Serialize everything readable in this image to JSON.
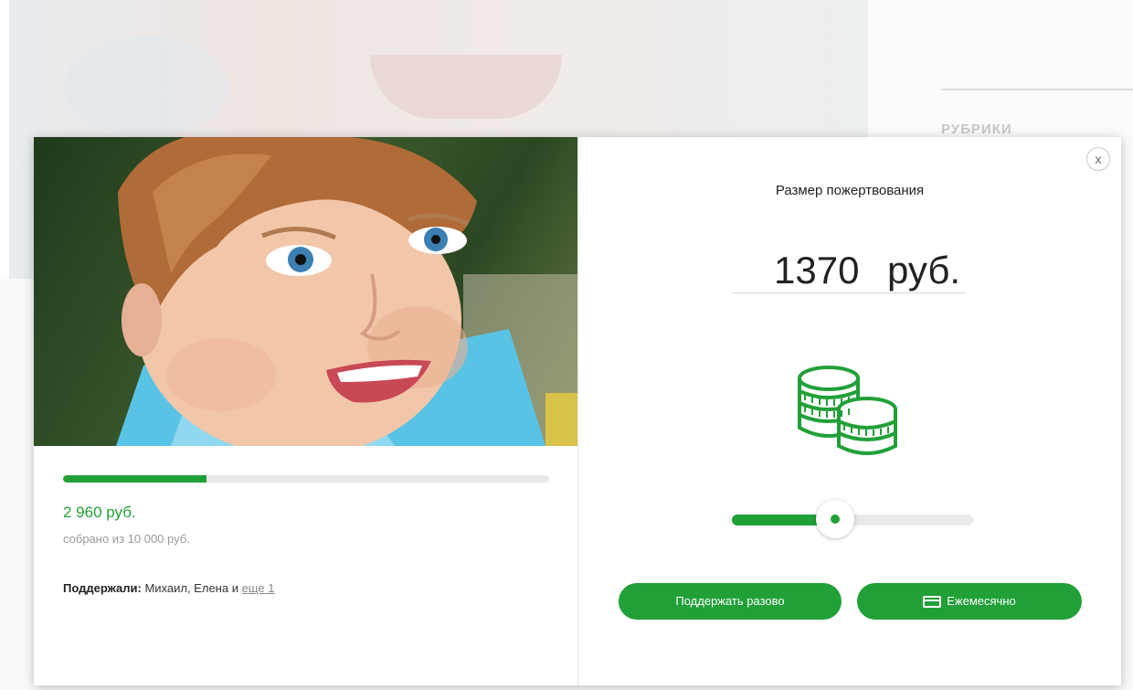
{
  "background": {
    "sidebar_heading": "РУБРИКИ"
  },
  "campaign": {
    "progress_fraction": 0.296,
    "raised": "2 960 руб.",
    "goal": "собрано из 10 000 руб.",
    "supporters_label": "Поддержали:",
    "supporters_names": "Михаил, Елена и",
    "supporters_more": "еще 1"
  },
  "donation": {
    "close_label": "x",
    "title": "Размер пожертвования",
    "amount": "1370",
    "currency": "руб.",
    "slider_fraction": 0.37,
    "icon": "coins-icon"
  },
  "buttons": {
    "once": "Поддержать разово",
    "monthly": "Ежемесячно"
  },
  "colors": {
    "accent": "#21a038",
    "track": "#e9e9e9"
  }
}
